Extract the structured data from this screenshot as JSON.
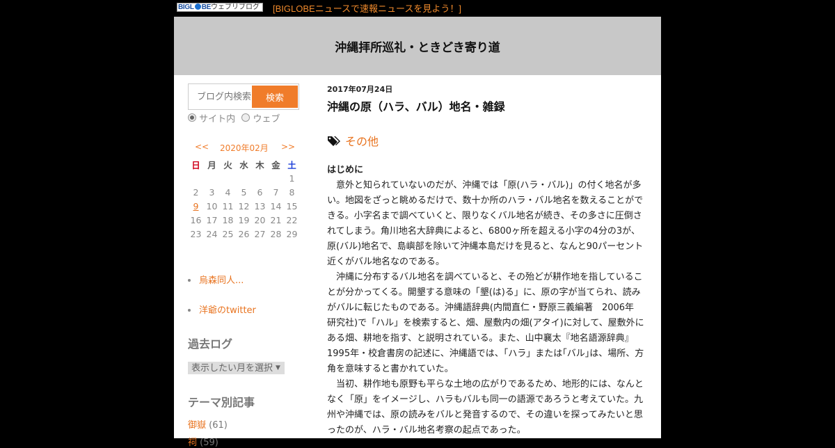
{
  "topbar": {
    "logo_text_big": "BIGL",
    "logo_text_be": "BE",
    "logo_text_rest": "ウェブリブログ",
    "news_link": "[BIGLOBEニュースで速報ニュースを見よう！]"
  },
  "header": {
    "site_title": "沖縄拝所巡礼・ときどき寄り道"
  },
  "search": {
    "placeholder": "ブログ内検索",
    "button_label": "検索",
    "scope_site": "サイト内",
    "scope_web": "ウェブ",
    "selected_scope": "サイト内"
  },
  "calendar": {
    "prev": "<<",
    "month": "2020年02月",
    "next": ">>",
    "weekdays": [
      "日",
      "月",
      "火",
      "水",
      "木",
      "金",
      "土"
    ],
    "weeks": [
      [
        "",
        "",
        "",
        "",
        "",
        "",
        "1"
      ],
      [
        "2",
        "3",
        "4",
        "5",
        "6",
        "7",
        "8"
      ],
      [
        "9",
        "10",
        "11",
        "12",
        "13",
        "14",
        "15"
      ],
      [
        "16",
        "17",
        "18",
        "19",
        "20",
        "21",
        "22"
      ],
      [
        "23",
        "24",
        "25",
        "26",
        "27",
        "28",
        "29"
      ]
    ],
    "linked_day": "9"
  },
  "sidebar_links": [
    {
      "label": "烏森同人..."
    },
    {
      "label": "洋爺のtwitter"
    }
  ],
  "archive": {
    "heading": "過去ログ",
    "select_label": "表示したい月を選択"
  },
  "categories": {
    "heading": "テーマ別記事",
    "items": [
      {
        "name": "御嶽",
        "count": "(61)"
      },
      {
        "name": "祠",
        "count": "(59)"
      }
    ]
  },
  "post": {
    "date": "2017年07月24日",
    "title": "沖縄の原（ハラ、バル）地名・雑録",
    "category": "その他",
    "body_heading": "はじめに",
    "paragraphs": [
      "　意外と知られていないのだが、沖縄では「原(ハラ・バル)」の付く地名が多い。地図をざっと眺めるだけで、数十か所のハラ・バル地名を数えることができる。小字名まで調べていくと、限りなくバル地名が続き、その多さに圧倒されてしまう。角川地名大辞典によると、6800ヶ所を超える小字の4分の3が、原(バル)地名で、島嶼部を除いて沖縄本島だけを見ると、なんと90パーセント近くがバル地名なのである。",
      "　沖縄に分布するバル地名を調べていると、その殆どが耕作地を指していることが分かってくる。開墾する意味の「墾(は)る」に、原の字が当てられ、読みがバルに転じたものである。沖縄語辞典(内間直仁・野原三義編著　2006年　研究社)で「ハル」を検索すると、畑、屋敷内の畑(アタイ)に対して、屋敷外にある畑、耕地を指す、と説明されている。また、山中襄太『地名語源辞典』1995年・校倉書房の記述に、沖縄語では、「ハラ」または｢バル｣は、場所、方角を意味すると書かれていた。",
      "　当初、耕作地も原野も平らな土地の広がりであるため、地形的には、なんとなく「原」をイメージし、ハラもバルも同一の語源であろうと考えていた。九州や沖縄では、原の読みをバルと発音するので、その違いを探ってみたいと思ったのが、ハラ・バル地名考察の起点であった。"
    ]
  },
  "colors": {
    "accent": "#f07c2a",
    "header_bg": "#c8c8c8",
    "page_bg": "#000000"
  }
}
